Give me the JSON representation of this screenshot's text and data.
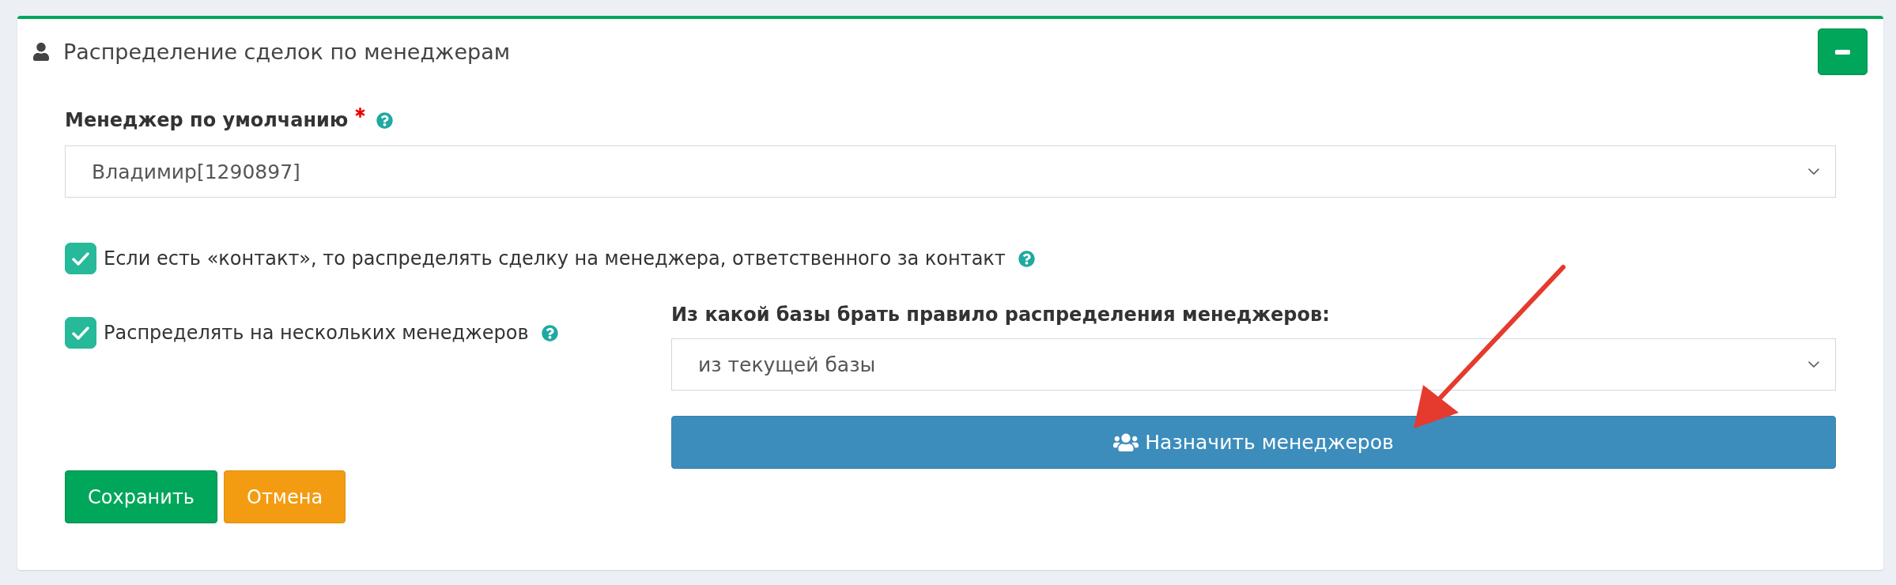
{
  "panel": {
    "title": "Распределение сделок по менеджерам",
    "expanded": true
  },
  "form": {
    "default_manager": {
      "label": "Менеджер по умолчанию",
      "required": true,
      "help": true,
      "value": "Владимир[1290897]"
    },
    "checkboxes": [
      {
        "label": "Если есть «контакт», то распределять сделку на менеджера, ответственного за контакт",
        "checked": true,
        "help": true
      },
      {
        "label": "Распределять на нескольких менеджеров",
        "checked": true,
        "help": true
      }
    ],
    "rule_source": {
      "label": "Из какой базы брать правило распределения менеджеров:",
      "value": "из текущей базы"
    },
    "assign_button": {
      "label": "Назначить менеджеров"
    },
    "actions": [
      {
        "label": "Сохранить",
        "kind": "save"
      },
      {
        "label": "Отмена",
        "kind": "cancel"
      }
    ]
  }
}
